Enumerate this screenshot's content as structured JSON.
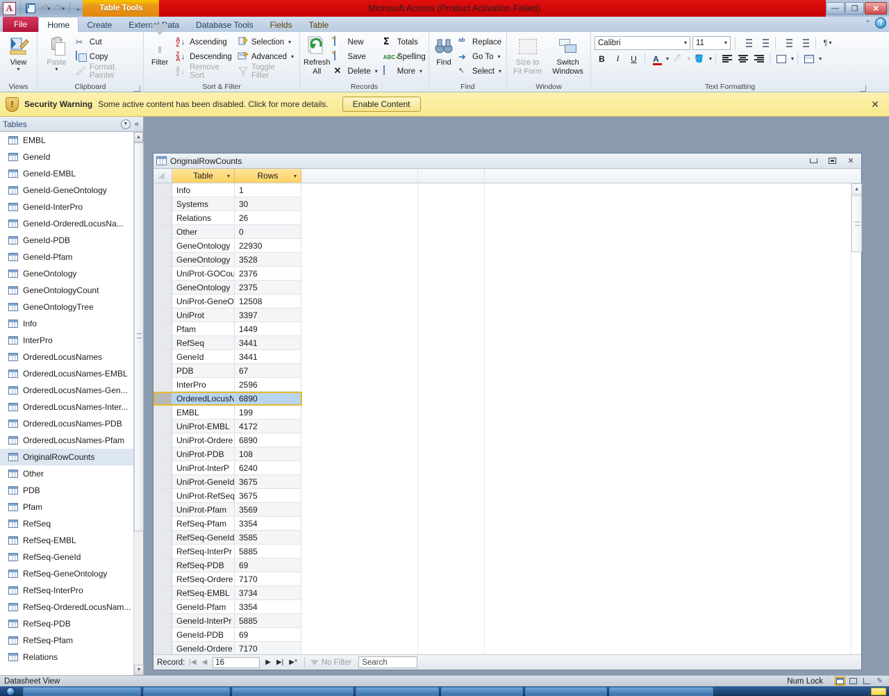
{
  "titlebar": {
    "logo": "A",
    "context_tab_group": "Table Tools",
    "app_title": "Microsoft Access (Product Activation Failed)",
    "minimize": "—",
    "restore": "❐",
    "close": "✕"
  },
  "tabs": [
    {
      "label": "File",
      "type": "file"
    },
    {
      "label": "Home",
      "type": "active"
    },
    {
      "label": "Create",
      "type": "normal"
    },
    {
      "label": "External Data",
      "type": "normal"
    },
    {
      "label": "Database Tools",
      "type": "normal"
    },
    {
      "label": "Fields",
      "type": "ctx"
    },
    {
      "label": "Table",
      "type": "ctx"
    }
  ],
  "help": {
    "caret": "⌃",
    "question": "?"
  },
  "ribbon": {
    "views": {
      "group_label": "Views",
      "view_label": "View",
      "caret": "▾"
    },
    "clipboard": {
      "group_label": "Clipboard",
      "paste_label": "Paste",
      "paste_caret": "▾",
      "cut": "Cut",
      "copy": "Copy",
      "format_painter": "Format Painter"
    },
    "sort_filter": {
      "group_label": "Sort & Filter",
      "filter_label": "Filter",
      "ascending": "Ascending",
      "descending": "Descending",
      "remove_sort": "Remove Sort",
      "selection": "Selection",
      "advanced": "Advanced",
      "toggle_filter": "Toggle Filter"
    },
    "records": {
      "group_label": "Records",
      "refresh_all": "Refresh",
      "refresh_all2": "All",
      "new": "New",
      "save": "Save",
      "delete": "Delete",
      "totals": "Totals",
      "spelling": "Spelling",
      "more": "More"
    },
    "find": {
      "group_label": "Find",
      "find_label": "Find",
      "replace": "Replace",
      "go_to": "Go To",
      "select": "Select"
    },
    "window": {
      "group_label": "Window",
      "size_to": "Size to",
      "fit_form": "Fit Form",
      "switch": "Switch",
      "windows": "Windows"
    },
    "text_formatting": {
      "group_label": "Text Formatting",
      "font_name": "Calibri",
      "font_size": "11",
      "bold": "B",
      "italic": "I",
      "underline": "U",
      "font_color": "A",
      "align_left": "align-left",
      "align_center": "align-center",
      "align_right": "align-right"
    }
  },
  "security_bar": {
    "title": "Security Warning",
    "message": "Some active content has been disabled. Click for more details.",
    "button": "Enable Content",
    "close": "✕"
  },
  "navigation_pane": {
    "title": "Tables",
    "collapse": "«",
    "items": [
      "EMBL",
      "GeneId",
      "GeneId-EMBL",
      "GeneId-GeneOntology",
      "GeneId-InterPro",
      "GeneId-OrderedLocusNa...",
      "GeneId-PDB",
      "GeneId-Pfam",
      "GeneOntology",
      "GeneOntologyCount",
      "GeneOntologyTree",
      "Info",
      "InterPro",
      "OrderedLocusNames",
      "OrderedLocusNames-EMBL",
      "OrderedLocusNames-Gen...",
      "OrderedLocusNames-Inter...",
      "OrderedLocusNames-PDB",
      "OrderedLocusNames-Pfam",
      "OriginalRowCounts",
      "Other",
      "PDB",
      "Pfam",
      "RefSeq",
      "RefSeq-EMBL",
      "RefSeq-GeneId",
      "RefSeq-GeneOntology",
      "RefSeq-InterPro",
      "RefSeq-OrderedLocusNam...",
      "RefSeq-PDB",
      "RefSeq-Pfam",
      "Relations"
    ],
    "selected": "OriginalRowCounts"
  },
  "document_window": {
    "title": "OriginalRowCounts",
    "minimize": "—",
    "restore": "▣",
    "close": "✕"
  },
  "datasheet": {
    "columns": [
      "Table",
      "Rows"
    ],
    "column_caret": "▾",
    "current_row_index": 15,
    "rows": [
      {
        "table": "Info",
        "rows": "1"
      },
      {
        "table": "Systems",
        "rows": "30"
      },
      {
        "table": "Relations",
        "rows": "26"
      },
      {
        "table": "Other",
        "rows": "0"
      },
      {
        "table": "GeneOntology",
        "rows": "22930"
      },
      {
        "table": "GeneOntology",
        "rows": "3528"
      },
      {
        "table": "UniProt-GOCou",
        "rows": "2376"
      },
      {
        "table": "GeneOntology",
        "rows": "2375"
      },
      {
        "table": "UniProt-GeneO",
        "rows": "12508"
      },
      {
        "table": "UniProt",
        "rows": "3397"
      },
      {
        "table": "Pfam",
        "rows": "1449"
      },
      {
        "table": "RefSeq",
        "rows": "3441"
      },
      {
        "table": "GeneId",
        "rows": "3441"
      },
      {
        "table": "PDB",
        "rows": "67"
      },
      {
        "table": "InterPro",
        "rows": "2596"
      },
      {
        "table": "OrderedLocusN",
        "rows": "6890"
      },
      {
        "table": "EMBL",
        "rows": "199"
      },
      {
        "table": "UniProt-EMBL",
        "rows": "4172"
      },
      {
        "table": "UniProt-Ordere",
        "rows": "6890"
      },
      {
        "table": "UniProt-PDB",
        "rows": "108"
      },
      {
        "table": "UniProt-InterP",
        "rows": "6240"
      },
      {
        "table": "UniProt-GeneId",
        "rows": "3675"
      },
      {
        "table": "UniProt-RefSeq",
        "rows": "3675"
      },
      {
        "table": "UniProt-Pfam",
        "rows": "3569"
      },
      {
        "table": "RefSeq-Pfam",
        "rows": "3354"
      },
      {
        "table": "RefSeq-GeneId",
        "rows": "3585"
      },
      {
        "table": "RefSeq-InterPr",
        "rows": "5885"
      },
      {
        "table": "RefSeq-PDB",
        "rows": "69"
      },
      {
        "table": "RefSeq-Ordere",
        "rows": "7170"
      },
      {
        "table": "RefSeq-EMBL",
        "rows": "3734"
      },
      {
        "table": "GeneId-Pfam",
        "rows": "3354"
      },
      {
        "table": "GeneId-InterPr",
        "rows": "5885"
      },
      {
        "table": "GeneId-PDB",
        "rows": "69"
      },
      {
        "table": "GeneId-Ordere",
        "rows": "7170"
      }
    ]
  },
  "record_navigator": {
    "label": "Record:",
    "first": "|◀",
    "prev": "◀",
    "current": "16",
    "next": "▶",
    "last": "▶|",
    "new": "▶*",
    "filter_status": "No Filter",
    "search_placeholder": "Search"
  },
  "status_bar": {
    "view_label": "Datasheet View",
    "num_lock": "Num Lock"
  }
}
